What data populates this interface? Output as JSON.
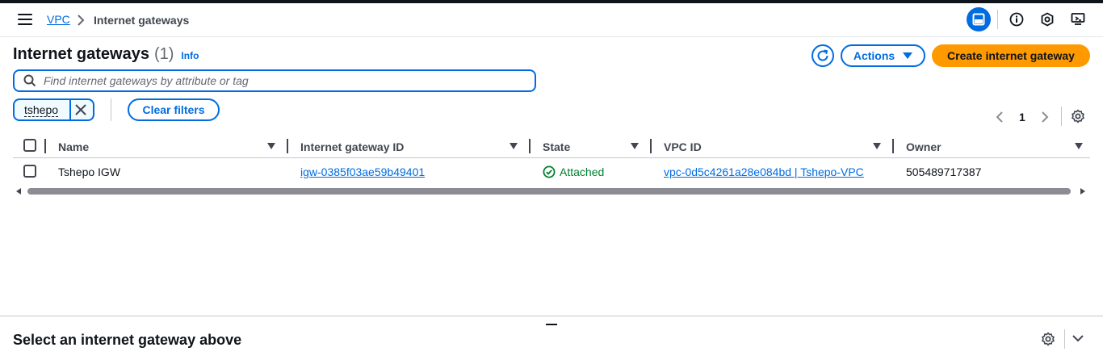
{
  "breadcrumb": {
    "root": "VPC",
    "current": "Internet gateways"
  },
  "header": {
    "title": "Internet gateways",
    "count": "(1)",
    "info": "Info",
    "actions_label": "Actions",
    "create_label": "Create internet gateway"
  },
  "search": {
    "placeholder": "Find internet gateways by attribute or tag",
    "value": ""
  },
  "filter": {
    "token": "tshepo",
    "clear_label": "Clear filters"
  },
  "pagination": {
    "page": "1"
  },
  "table": {
    "columns": [
      "Name",
      "Internet gateway ID",
      "State",
      "VPC ID",
      "Owner"
    ],
    "rows": [
      {
        "name": "Tshepo IGW",
        "id": "igw-0385f03ae59b49401",
        "state": "Attached",
        "vpc": "vpc-0d5c4261a28e084bd | Tshepo-VPC",
        "owner": "505489717387"
      }
    ]
  },
  "split_panel": {
    "title": "Select an internet gateway above"
  },
  "colors": {
    "accent": "#006ce0",
    "primary_button": "#ff9900",
    "success": "#00802f"
  },
  "icons": [
    "menu-icon",
    "chevron-right-icon",
    "panel-icon",
    "info-icon",
    "hexagon-icon",
    "feedback-icon",
    "refresh-icon",
    "caret-down-icon",
    "search-icon",
    "close-icon",
    "chevron-left-icon",
    "gear-icon",
    "check-circle-icon",
    "chevron-down-icon"
  ]
}
